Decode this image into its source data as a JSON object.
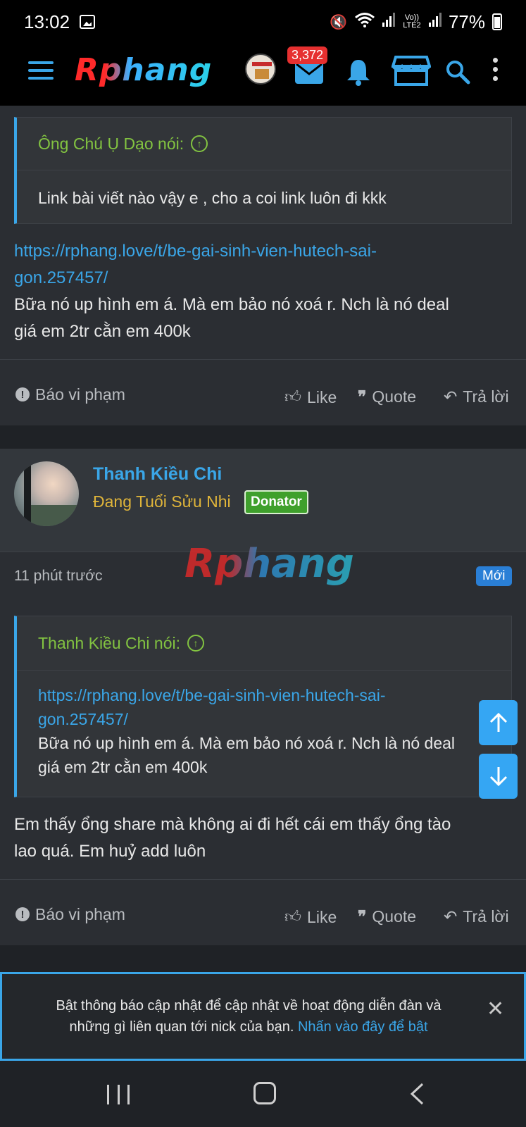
{
  "status_bar": {
    "time": "13:02",
    "battery": "77%",
    "signal_label": "Vo)) LTE2"
  },
  "header": {
    "logo": "Rphang",
    "inbox_badge": "3,372",
    "icons": [
      "menu-icon",
      "inbox-icon",
      "bell-icon",
      "store-icon",
      "search-icon",
      "more-icon"
    ],
    "accent": "#3aa6e8"
  },
  "post1": {
    "quote_author": "Ông Chú Ụ Dạo nói:",
    "quote_text": "Link bài viết nào vậy e , cho a coi link luôn đi kkk",
    "link_line1": "https://rphang.love/t/be-gai-sinh-vien-hutech-sai-",
    "link_line2": "gon.257457/",
    "message_line1": "Bữa nó up hình em á. Mà em bảo nó xoá r. Nch là nó deal",
    "message_line2": "giá em 2tr cằn em 400k",
    "actions": {
      "report": "Báo vi phạm",
      "like": "Like",
      "quote": "Quote",
      "reply": "Trả lời"
    }
  },
  "post2": {
    "username": "Thanh Kiều Chi",
    "user_title": "Đang Tuổi Sửu Nhi",
    "badge": "Donator",
    "watermark": "Rphang",
    "timestamp": "11 phút trước",
    "new_label": "Mới",
    "quote_author": "Thanh Kiều Chi nói:",
    "quote_link_line1": "https://rphang.love/t/be-gai-sinh-vien-hutech-sai-",
    "quote_link_line2": "gon.257457/",
    "quote_text_line1": "Bữa nó up hình em á. Mà em bảo nó xoá r. Nch là nó deal",
    "quote_text_line2": "giá em 2tr cằn em 400k",
    "message_line1": "Em thấy ổng share mà không ai đi hết cái em thấy ổng tào",
    "message_line2": "lao quá. Em huỷ add luôn",
    "actions": {
      "report": "Báo vi phạm",
      "like": "Like",
      "quote": "Quote",
      "reply": "Trả lời"
    }
  },
  "notification": {
    "text_line1": "Bật thông báo cập nhật để cập nhật về hoạt động diễn đàn và",
    "text_line2": "những gì liên quan tới nick của bạn.",
    "link": "Nhấn vào đây để bật"
  }
}
